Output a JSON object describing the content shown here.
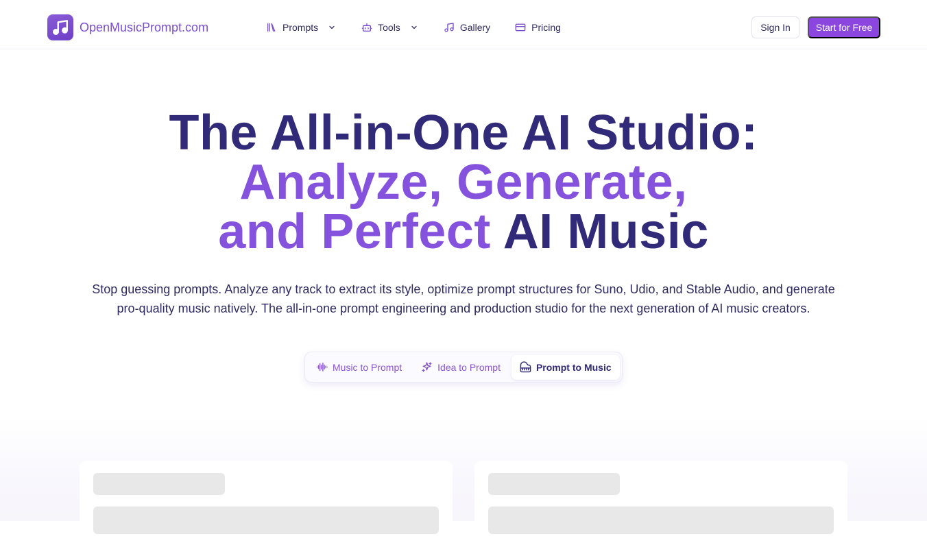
{
  "header": {
    "logo_text": "OpenMusicPrompt.com",
    "nav": [
      {
        "label": "Prompts",
        "icon": "library-icon",
        "has_dropdown": true
      },
      {
        "label": "Tools",
        "icon": "bot-icon",
        "has_dropdown": true
      },
      {
        "label": "Gallery",
        "icon": "music-note-icon",
        "has_dropdown": false
      },
      {
        "label": "Pricing",
        "icon": "credit-card-icon",
        "has_dropdown": false
      }
    ],
    "sign_in": "Sign In",
    "start_free": "Start for Free"
  },
  "hero": {
    "title_line1": "The All-in-One AI Studio:",
    "title_line2": "Analyze, Generate,",
    "title_line3_accent": "and Perfect",
    "title_line3_dark": "AI Music",
    "subtitle": "Stop guessing prompts. Analyze any track to extract its style, optimize prompt structures for Suno, Udio, and Stable Audio, and generate pro-quality music natively. The all-in-one prompt engineering and production studio for the next generation of AI music creators."
  },
  "mode_tabs": [
    {
      "label": "Music to Prompt",
      "icon": "audio-waveform-icon",
      "active": false
    },
    {
      "label": "Idea to Prompt",
      "icon": "sparkles-icon",
      "active": false
    },
    {
      "label": "Prompt to Music",
      "icon": "piano-icon",
      "active": true
    }
  ],
  "colors": {
    "brand": "#8b46e0",
    "heading_dark": "#302a78",
    "heading_accent": "#8452dd",
    "skeleton": "#e8e8e9"
  }
}
